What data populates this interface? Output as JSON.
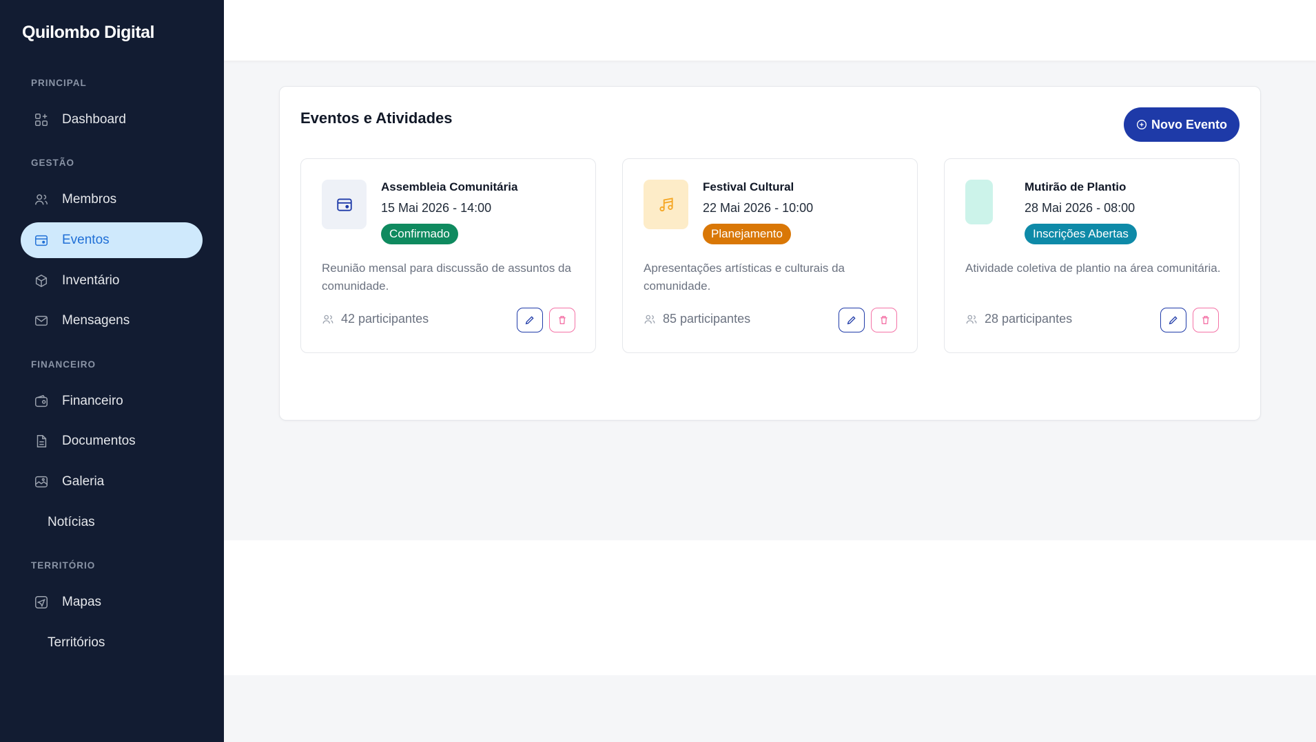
{
  "app": {
    "brand": "Quilombo Digital"
  },
  "sidebar": {
    "sections": [
      {
        "label": "PRINCIPAL"
      },
      {
        "label": "GESTÃO"
      },
      {
        "label": "FINANCEIRO"
      },
      {
        "label": "TERRITÓRIO"
      }
    ],
    "items": [
      {
        "label": "Dashboard",
        "icon": "dashboard-icon"
      },
      {
        "label": "Membros",
        "icon": "users-icon"
      },
      {
        "label": "Eventos",
        "icon": "calendar-icon",
        "active": true
      },
      {
        "label": "Inventário",
        "icon": "box-icon"
      },
      {
        "label": "Mensagens",
        "icon": "mail-icon"
      },
      {
        "label": "Financeiro",
        "icon": "wallet-icon"
      },
      {
        "label": "Documentos",
        "icon": "document-icon"
      },
      {
        "label": "Galeria",
        "icon": "image-icon"
      },
      {
        "label": "Notícias",
        "icon": null
      },
      {
        "label": "Mapas",
        "icon": "map-icon"
      },
      {
        "label": "Territórios",
        "icon": null
      }
    ]
  },
  "main": {
    "title": "Eventos e Atividades",
    "new_button_label": "Novo Evento",
    "events": [
      {
        "title": "Assembleia Comunitária",
        "date": "15 Mai 2026 - 14:00",
        "status": "Confirmado",
        "status_color": "#0f8a5f",
        "thumb_bg": "#eef1f7",
        "thumb_icon": "calendar-icon",
        "description": "Reunião mensal para discussão de assuntos da comunidade.",
        "participants": "42 participantes"
      },
      {
        "title": "Festival Cultural",
        "date": "22 Mai 2026 - 10:00",
        "status": "Planejamento",
        "status_color": "#d97706",
        "thumb_bg": "#fdecc8",
        "thumb_icon": "music-icon",
        "description": "Apresentações artísticas e culturais da comunidade.",
        "participants": "85 participantes"
      },
      {
        "title": "Mutirão de Plantio",
        "date": "28 Mai 2026 - 08:00",
        "status": "Inscrições Abertas",
        "status_color": "#0e8aa8",
        "thumb_bg": "#ccf3ea",
        "thumb_icon": null,
        "description": "Atividade coletiva de plantio na área comunitária.",
        "participants": "28 participantes"
      }
    ]
  },
  "colors": {
    "sidebar_bg": "#121c32",
    "active_bg": "#cfe9fc",
    "active_text": "#1f6fd6",
    "primary": "#1e3aa8",
    "danger": "#f472a6"
  }
}
